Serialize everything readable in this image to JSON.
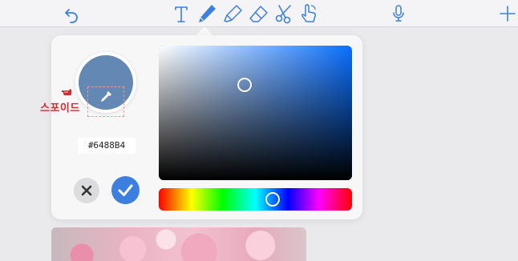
{
  "toolbar": {
    "items": [
      {
        "name": "undo-button",
        "icon": "undo-icon"
      },
      {
        "name": "text-tool-button",
        "icon": "text-t-icon"
      },
      {
        "name": "pen-tool-button",
        "icon": "pen-icon",
        "selected": true
      },
      {
        "name": "highlighter-tool-button",
        "icon": "highlighter-icon"
      },
      {
        "name": "eraser-tool-button",
        "icon": "eraser-icon"
      },
      {
        "name": "scissors-tool-button",
        "icon": "scissors-icon"
      },
      {
        "name": "touch-tool-button",
        "icon": "pointing-hand-icon"
      },
      {
        "name": "microphone-button",
        "icon": "microphone-icon"
      },
      {
        "name": "add-button",
        "icon": "plus-icon"
      }
    ],
    "icon_color": "#3d7fe0"
  },
  "color_picker": {
    "hex_value": "#6488B4",
    "selected_color": "#6488B4",
    "hue_color": "#0a6fff",
    "saturation": 0.44,
    "brightness": 0.71,
    "hue_level": 0.59
  },
  "annotation": {
    "label": "스포이드",
    "label_color": "#d8282f"
  },
  "actions": {
    "cancel_icon": "close-icon",
    "confirm_icon": "checkmark-icon",
    "confirm_color": "#3d7fe0"
  }
}
